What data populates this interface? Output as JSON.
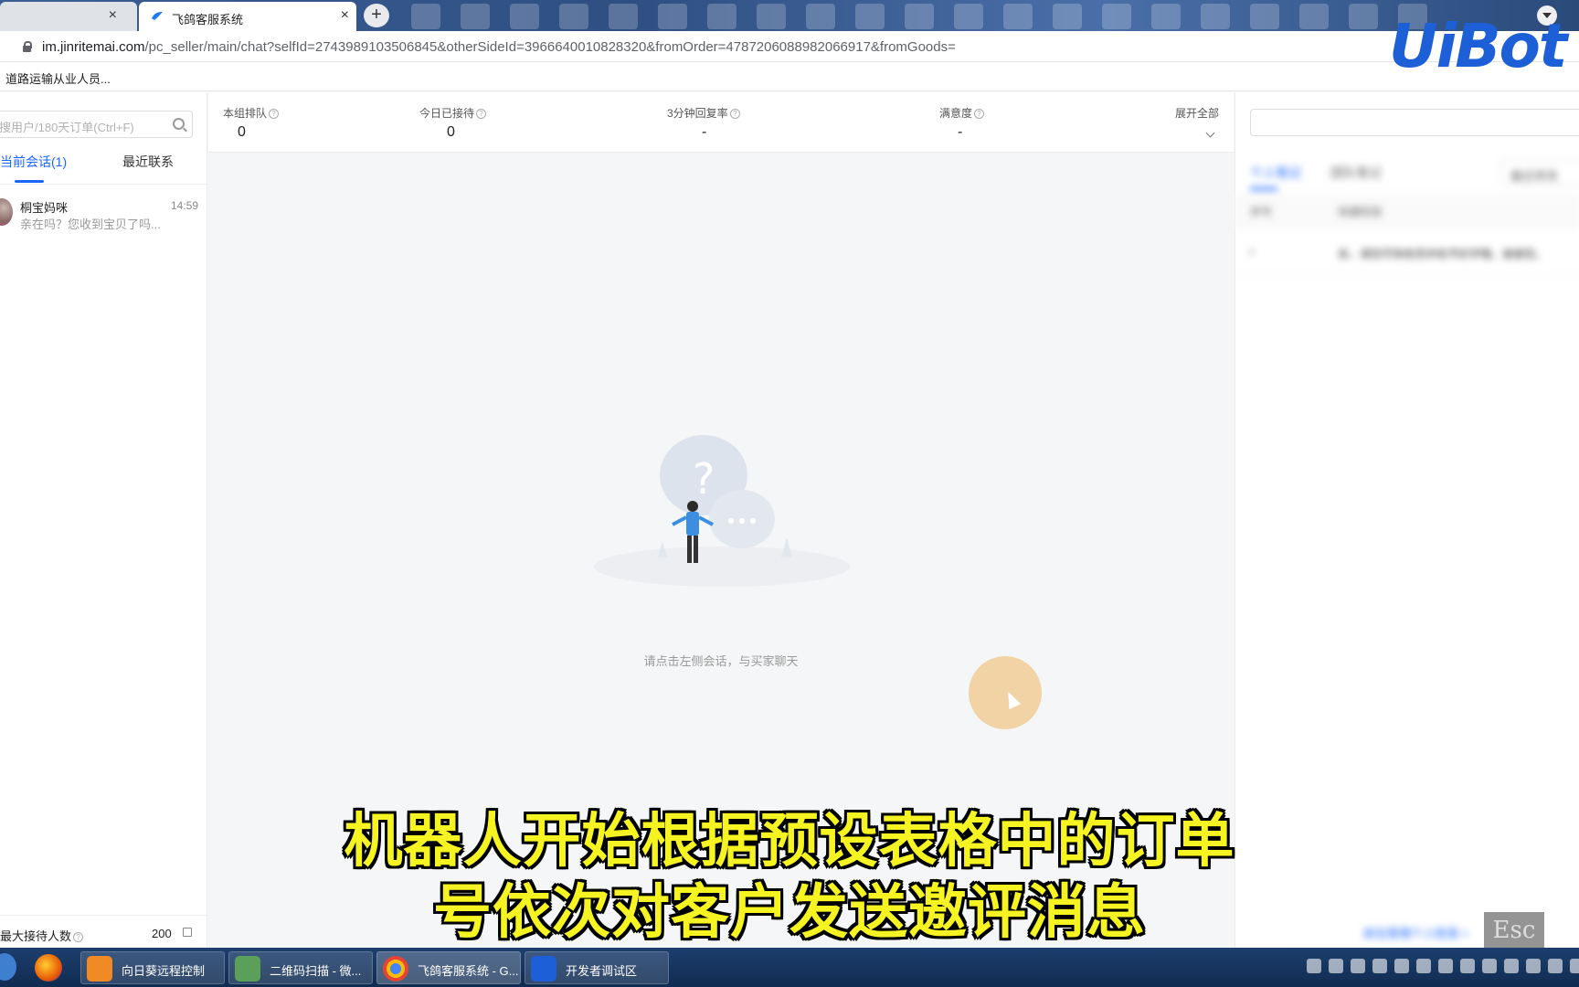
{
  "browser": {
    "prev_tab_close": "×",
    "active_tab": {
      "title": "飞鸽客服系统",
      "close": "×"
    },
    "new_tab": "+",
    "url_host": "im.jinritemai.com",
    "url_path": "/pc_seller/main/chat?selfId=2743989103506845&otherSideId=3966640010828320&fromOrder=4787206088982066917&fromGoods=",
    "bookmark": "道路运输从业人员..."
  },
  "watermark_logo": "UiBot",
  "left_panel": {
    "search_placeholder": "搜用户/180天订单(Ctrl+F)",
    "tabs": [
      {
        "label": "当前会话(1)",
        "active": true
      },
      {
        "label": "最近联系",
        "active": false
      }
    ],
    "sessions": [
      {
        "name": "桐宝妈咪",
        "time": "14:59",
        "message": "亲在吗？您收到宝贝了吗..."
      }
    ],
    "max_reception_label": "最大接待人数",
    "max_reception_value": "200"
  },
  "stats": [
    {
      "label": "本组排队",
      "value": "0"
    },
    {
      "label": "今日已接待",
      "value": "0"
    },
    {
      "label": "3分钟回复率",
      "value": "-"
    },
    {
      "label": "满意度",
      "value": "-"
    }
  ],
  "expand_all": "展开全部",
  "empty_state": {
    "text": "请点击左侧会话，与买家聊天"
  },
  "right_panel": {
    "tab_personal": "个人笔记",
    "tab_team": "团队笔记",
    "sort_select": "最近修改",
    "col_index": "序号",
    "col_content": "快捷短语",
    "row_index": "/",
    "row_content": "亲，请您尽快收货并给予好评哦，谢谢您。",
    "manage_link": "前往管理个人短语 >"
  },
  "esc_key": "Esc",
  "subtitle": {
    "line1": "机器人开始根据预设表格中的订单",
    "line2": "号依次对客户发送邀评消息"
  },
  "taskbar": {
    "items": [
      {
        "label": "向日葵远程控制",
        "color": "#f08a24"
      },
      {
        "label": "二维码扫描 - 微...",
        "color": "#5aa05a"
      },
      {
        "label": "飞鸽客服系统 - G...",
        "color": "#e84335"
      },
      {
        "label": "开发者调试区",
        "color": "#1d5fd6"
      }
    ]
  },
  "colors": {
    "accent": "#1966ff",
    "subtitle": "#f5f321"
  }
}
